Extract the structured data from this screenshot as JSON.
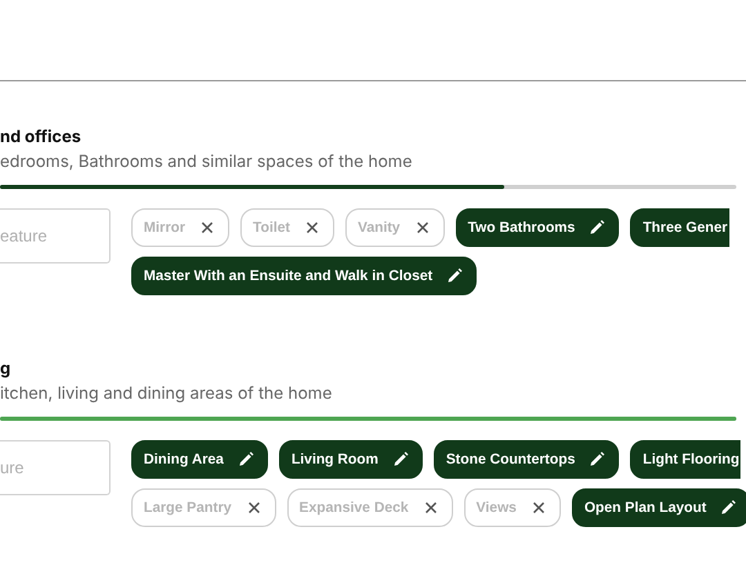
{
  "sections": [
    {
      "title": "nd offices",
      "description": "edrooms, Bathrooms and similar spaces of the home",
      "level": 0.685,
      "input": {
        "placeholder": "eature"
      },
      "chip_rows": [
        [
          {
            "label": "Mirror",
            "selected": false,
            "clipped": false
          },
          {
            "label": "Toilet",
            "selected": false,
            "clipped": false
          },
          {
            "label": "Vanity",
            "selected": false,
            "clipped": false
          },
          {
            "label": "Two Bathrooms",
            "selected": true,
            "clipped": false
          },
          {
            "label": "Three Gener",
            "selected": true,
            "clipped": true
          }
        ],
        [
          {
            "label": "Master With an Ensuite and Walk in Closet",
            "selected": true,
            "clipped": false
          }
        ]
      ]
    },
    {
      "title": "g",
      "description": "itchen, living and dining areas of the home",
      "level": 1,
      "input": {
        "placeholder": "ure"
      },
      "chip_rows": [
        [
          {
            "label": "Dining Area",
            "selected": true,
            "clipped": false
          },
          {
            "label": "Living Room",
            "selected": true,
            "clipped": false
          },
          {
            "label": "Stone Countertops",
            "selected": true,
            "clipped": false
          },
          {
            "label": "Light Flooring",
            "selected": true,
            "clipped": true
          }
        ],
        [
          {
            "label": "Large Pantry",
            "selected": false,
            "clipped": false
          },
          {
            "label": "Expansive Deck",
            "selected": false,
            "clipped": false
          },
          {
            "label": "Views",
            "selected": false,
            "clipped": false
          },
          {
            "label": "Open Plan Layout",
            "selected": true,
            "clipped": false
          }
        ]
      ]
    }
  ]
}
